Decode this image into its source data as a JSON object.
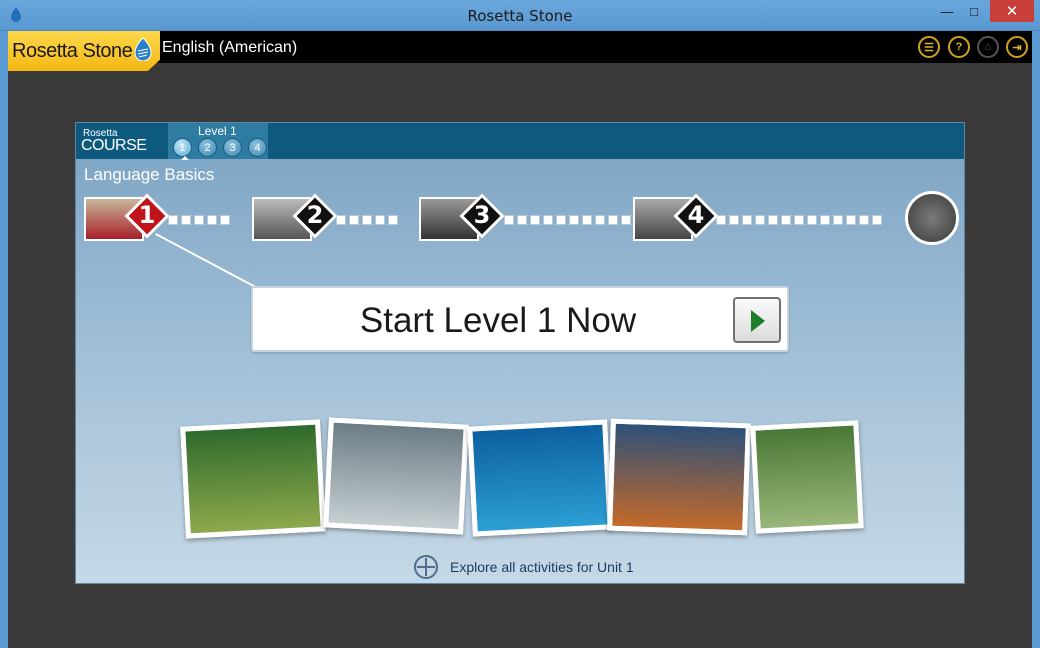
{
  "window": {
    "title": "Rosetta Stone",
    "minimize_icon": "minimize-icon",
    "maximize_icon": "maximize-icon",
    "close_icon": "close-icon",
    "min_glyph": "—",
    "max_glyph": "□",
    "close_glyph": "✕"
  },
  "header": {
    "logo_text": "Rosetta Stone",
    "language": "English (American)",
    "tools": [
      {
        "name": "menu-icon",
        "glyph": "☰"
      },
      {
        "name": "help-icon",
        "glyph": "?"
      },
      {
        "name": "home-icon",
        "glyph": "⌂"
      },
      {
        "name": "exit-icon",
        "glyph": "⇥"
      }
    ]
  },
  "course": {
    "brand_small": "Rosetta",
    "brand_big": "COURSE",
    "level_label": "Level 1",
    "level_dots": [
      "1",
      "2",
      "3",
      "4"
    ],
    "active_level": 1,
    "section_title": "Language Basics",
    "units": [
      "1",
      "2",
      "3",
      "4"
    ],
    "unit_colors": [
      "#c0141a",
      "#111111",
      "#111111",
      "#111111"
    ]
  },
  "start": {
    "label": "Start Level 1 Now",
    "play_icon": "play-icon"
  },
  "explore": {
    "label": "Explore all activities for Unit 1",
    "icon": "compass-icon"
  },
  "colors": {
    "brand_yellow": "#f3b814",
    "panel_header": "#0e5a7f",
    "play_green": "#1c7e2b"
  }
}
